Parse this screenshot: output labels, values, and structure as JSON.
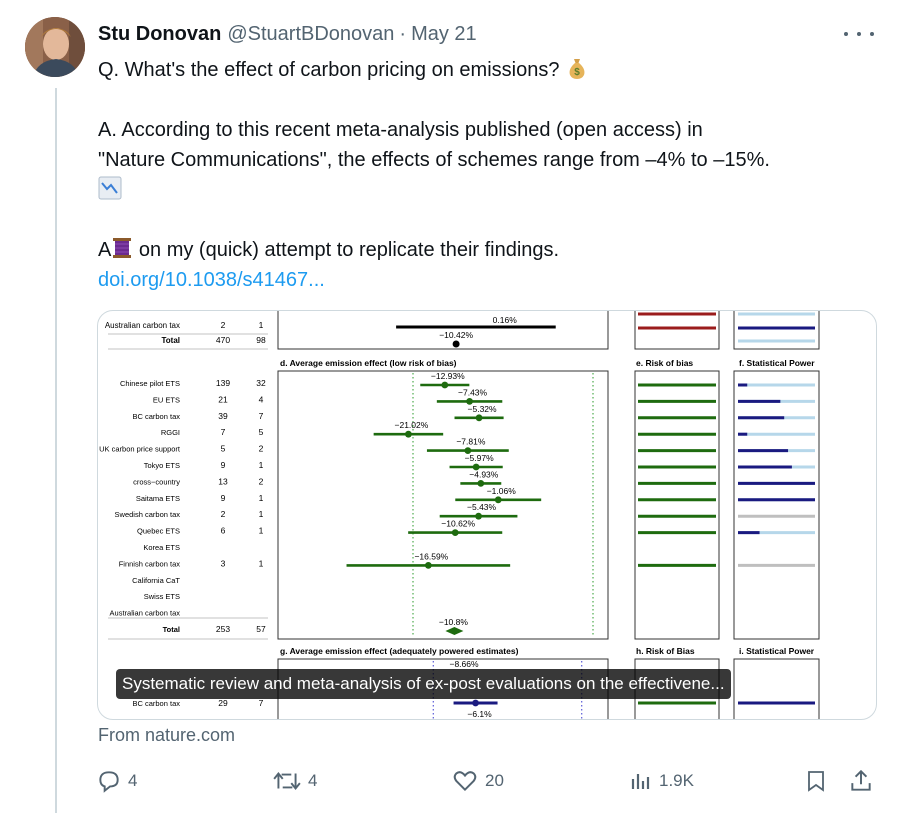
{
  "tweet": {
    "author_name": "Stu Donovan",
    "handle": "@StuartBDonovan",
    "separator": "·",
    "date": "May 21",
    "line1": "Q. What's the effect of carbon pricing on emissions?",
    "line2": "A. According to this recent meta-analysis published (open access) in",
    "line3": "\"Nature Communications\", the effects of schemes range from –4% to –15%.",
    "line4_pre": "A",
    "line4_post": "on my (quick) attempt to replicate their findings.",
    "link": "doi.org/10.1038/s41467..."
  },
  "card": {
    "caption": "Systematic review and meta-analysis of ex-post evaluations on the effectivene...",
    "source": "From nature.com",
    "figure": {
      "top_rows": [
        {
          "label": "Australian carbon tax",
          "n1": "2",
          "n2": "1"
        },
        {
          "label": "Total",
          "n1": "470",
          "n2": "98"
        }
      ],
      "top_estimates": [
        "0.16%",
        "−10.42%"
      ],
      "panel_d_title": "d. Average emission effect (low risk of bias)",
      "panel_e_title": "e. Risk of bias",
      "panel_f_title": "f. Statistical Power",
      "rows": [
        {
          "label": "Chinese pilot ETS",
          "n1": "139",
          "n2": "32",
          "est": "−12.93%",
          "val": -12.93
        },
        {
          "label": "EU ETS",
          "n1": "21",
          "n2": "4",
          "est": "−7.43%",
          "val": -7.43
        },
        {
          "label": "BC carbon tax",
          "n1": "39",
          "n2": "7",
          "est": "−5.32%",
          "val": -5.32
        },
        {
          "label": "RGGI",
          "n1": "7",
          "n2": "5",
          "est": "−21.02%",
          "val": -21.02
        },
        {
          "label": "UK carbon price support",
          "n1": "5",
          "n2": "2",
          "est": "−7.81%",
          "val": -7.81
        },
        {
          "label": "Tokyo ETS",
          "n1": "9",
          "n2": "1",
          "est": "−5.97%",
          "val": -5.97
        },
        {
          "label": "cross−country",
          "n1": "13",
          "n2": "2",
          "est": "−4.93%",
          "val": -4.93
        },
        {
          "label": "Saitama ETS",
          "n1": "9",
          "n2": "1",
          "est": "−1.06%",
          "val": -1.06
        },
        {
          "label": "Swedish carbon tax",
          "n1": "2",
          "n2": "1",
          "est": "−5.43%",
          "val": -5.43
        },
        {
          "label": "Quebec ETS",
          "n1": "6",
          "n2": "1",
          "est": "−10.62%",
          "val": -10.62
        },
        {
          "label": "Korea ETS",
          "n1": "",
          "n2": "",
          "est": "",
          "val": null
        },
        {
          "label": "Finnish carbon tax",
          "n1": "3",
          "n2": "1",
          "est": "−16.59%",
          "val": -16.59
        },
        {
          "label": "California CaT",
          "n1": "",
          "n2": "",
          "est": "",
          "val": null
        },
        {
          "label": "Swiss ETS",
          "n1": "",
          "n2": "",
          "est": "",
          "val": null
        },
        {
          "label": "Australian carbon tax",
          "n1": "",
          "n2": "",
          "est": "",
          "val": null
        }
      ],
      "total": {
        "label": "Total",
        "n1": "253",
        "n2": "57",
        "est": "−10.8%",
        "val": -10.8
      },
      "panel_g_title": "g. Average emission effect (adequately powered estimates)",
      "panel_h_title": "h. Risk of Bias",
      "panel_i_title": "i. Statistical Power",
      "bottom_rows": [
        {
          "label": "BC carbon tax",
          "n1": "29",
          "n2": "7"
        }
      ],
      "bottom_estimates": [
        "−8.66%",
        "−6.1%"
      ]
    }
  },
  "actions": {
    "reply_count": "4",
    "repost_count": "4",
    "like_count": "20",
    "views_count": "1.9K"
  },
  "colors": {
    "link": "#1d9bf0",
    "muted": "#536471",
    "forest_green": "#1e6b0f",
    "navy": "#1a1a80",
    "bias_red": "#9b1c1c",
    "light_blue": "#b6d7ea",
    "gray_bar": "#bfbfbf"
  }
}
